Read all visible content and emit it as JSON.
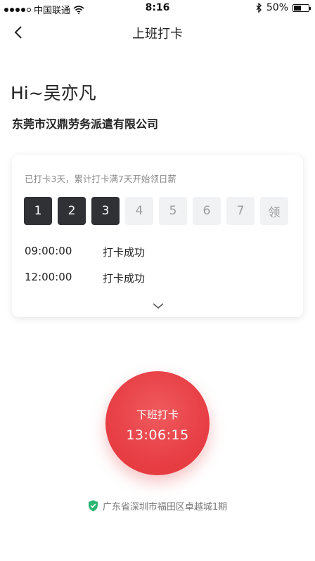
{
  "status_bar": {
    "carrier": "中国联通",
    "time": "8:16",
    "battery": "50%",
    "battery_level": 0.5
  },
  "nav": {
    "title": "上班打卡"
  },
  "greeting": "Hi~吴亦凡",
  "company": "东莞市汉鼎劳务派遣有限公司",
  "card": {
    "tip": "已打卡3天，累计打卡满7天开始领日薪",
    "days": [
      {
        "label": "1",
        "done": true
      },
      {
        "label": "2",
        "done": true
      },
      {
        "label": "3",
        "done": true
      },
      {
        "label": "4",
        "done": false
      },
      {
        "label": "5",
        "done": false
      },
      {
        "label": "6",
        "done": false
      },
      {
        "label": "7",
        "done": false
      },
      {
        "label": "领",
        "done": false
      }
    ],
    "records": [
      {
        "time": "09:00:00",
        "status": "打卡成功"
      },
      {
        "time": "12:00:00",
        "status": "打卡成功"
      }
    ]
  },
  "clock_button": {
    "label": "下班打卡",
    "time": "13:06:15"
  },
  "location": {
    "text": "广东省深圳市福田区卓越城1期"
  },
  "colors": {
    "accent_red": "#e73f45",
    "done_day": "#2f3135",
    "location_check": "#2bb673"
  }
}
